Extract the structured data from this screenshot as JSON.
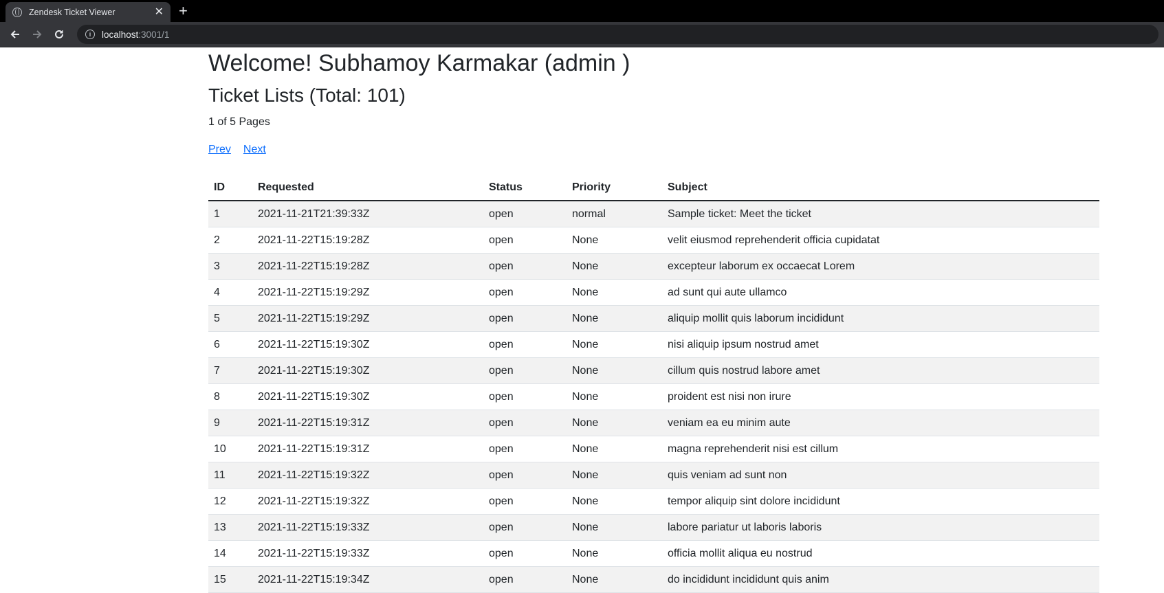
{
  "browser": {
    "tab_title": "Zendesk Ticket Viewer",
    "tab_close": "✕",
    "new_tab": "+",
    "url_host": "localhost",
    "url_path": ":3001/1"
  },
  "page": {
    "welcome": "Welcome! Subhamoy Karmakar (admin )",
    "ticket_heading": "Ticket Lists (Total: 101)",
    "pages_text": "1 of 5 Pages",
    "prev_label": "Prev",
    "next_label": "Next"
  },
  "table": {
    "headers": [
      "ID",
      "Requested",
      "Status",
      "Priority",
      "Subject"
    ],
    "rows": [
      {
        "id": "1",
        "requested": "2021-11-21T21:39:33Z",
        "status": "open",
        "priority": "normal",
        "subject": "Sample ticket: Meet the ticket"
      },
      {
        "id": "2",
        "requested": "2021-11-22T15:19:28Z",
        "status": "open",
        "priority": "None",
        "subject": "velit eiusmod reprehenderit officia cupidatat"
      },
      {
        "id": "3",
        "requested": "2021-11-22T15:19:28Z",
        "status": "open",
        "priority": "None",
        "subject": "excepteur laborum ex occaecat Lorem"
      },
      {
        "id": "4",
        "requested": "2021-11-22T15:19:29Z",
        "status": "open",
        "priority": "None",
        "subject": "ad sunt qui aute ullamco"
      },
      {
        "id": "5",
        "requested": "2021-11-22T15:19:29Z",
        "status": "open",
        "priority": "None",
        "subject": "aliquip mollit quis laborum incididunt"
      },
      {
        "id": "6",
        "requested": "2021-11-22T15:19:30Z",
        "status": "open",
        "priority": "None",
        "subject": "nisi aliquip ipsum nostrud amet"
      },
      {
        "id": "7",
        "requested": "2021-11-22T15:19:30Z",
        "status": "open",
        "priority": "None",
        "subject": "cillum quis nostrud labore amet"
      },
      {
        "id": "8",
        "requested": "2021-11-22T15:19:30Z",
        "status": "open",
        "priority": "None",
        "subject": "proident est nisi non irure"
      },
      {
        "id": "9",
        "requested": "2021-11-22T15:19:31Z",
        "status": "open",
        "priority": "None",
        "subject": "veniam ea eu minim aute"
      },
      {
        "id": "10",
        "requested": "2021-11-22T15:19:31Z",
        "status": "open",
        "priority": "None",
        "subject": "magna reprehenderit nisi est cillum"
      },
      {
        "id": "11",
        "requested": "2021-11-22T15:19:32Z",
        "status": "open",
        "priority": "None",
        "subject": "quis veniam ad sunt non"
      },
      {
        "id": "12",
        "requested": "2021-11-22T15:19:32Z",
        "status": "open",
        "priority": "None",
        "subject": "tempor aliquip sint dolore incididunt"
      },
      {
        "id": "13",
        "requested": "2021-11-22T15:19:33Z",
        "status": "open",
        "priority": "None",
        "subject": "labore pariatur ut laboris laboris"
      },
      {
        "id": "14",
        "requested": "2021-11-22T15:19:33Z",
        "status": "open",
        "priority": "None",
        "subject": "officia mollit aliqua eu nostrud"
      },
      {
        "id": "15",
        "requested": "2021-11-22T15:19:34Z",
        "status": "open",
        "priority": "None",
        "subject": "do incididunt incididunt quis anim"
      }
    ]
  }
}
